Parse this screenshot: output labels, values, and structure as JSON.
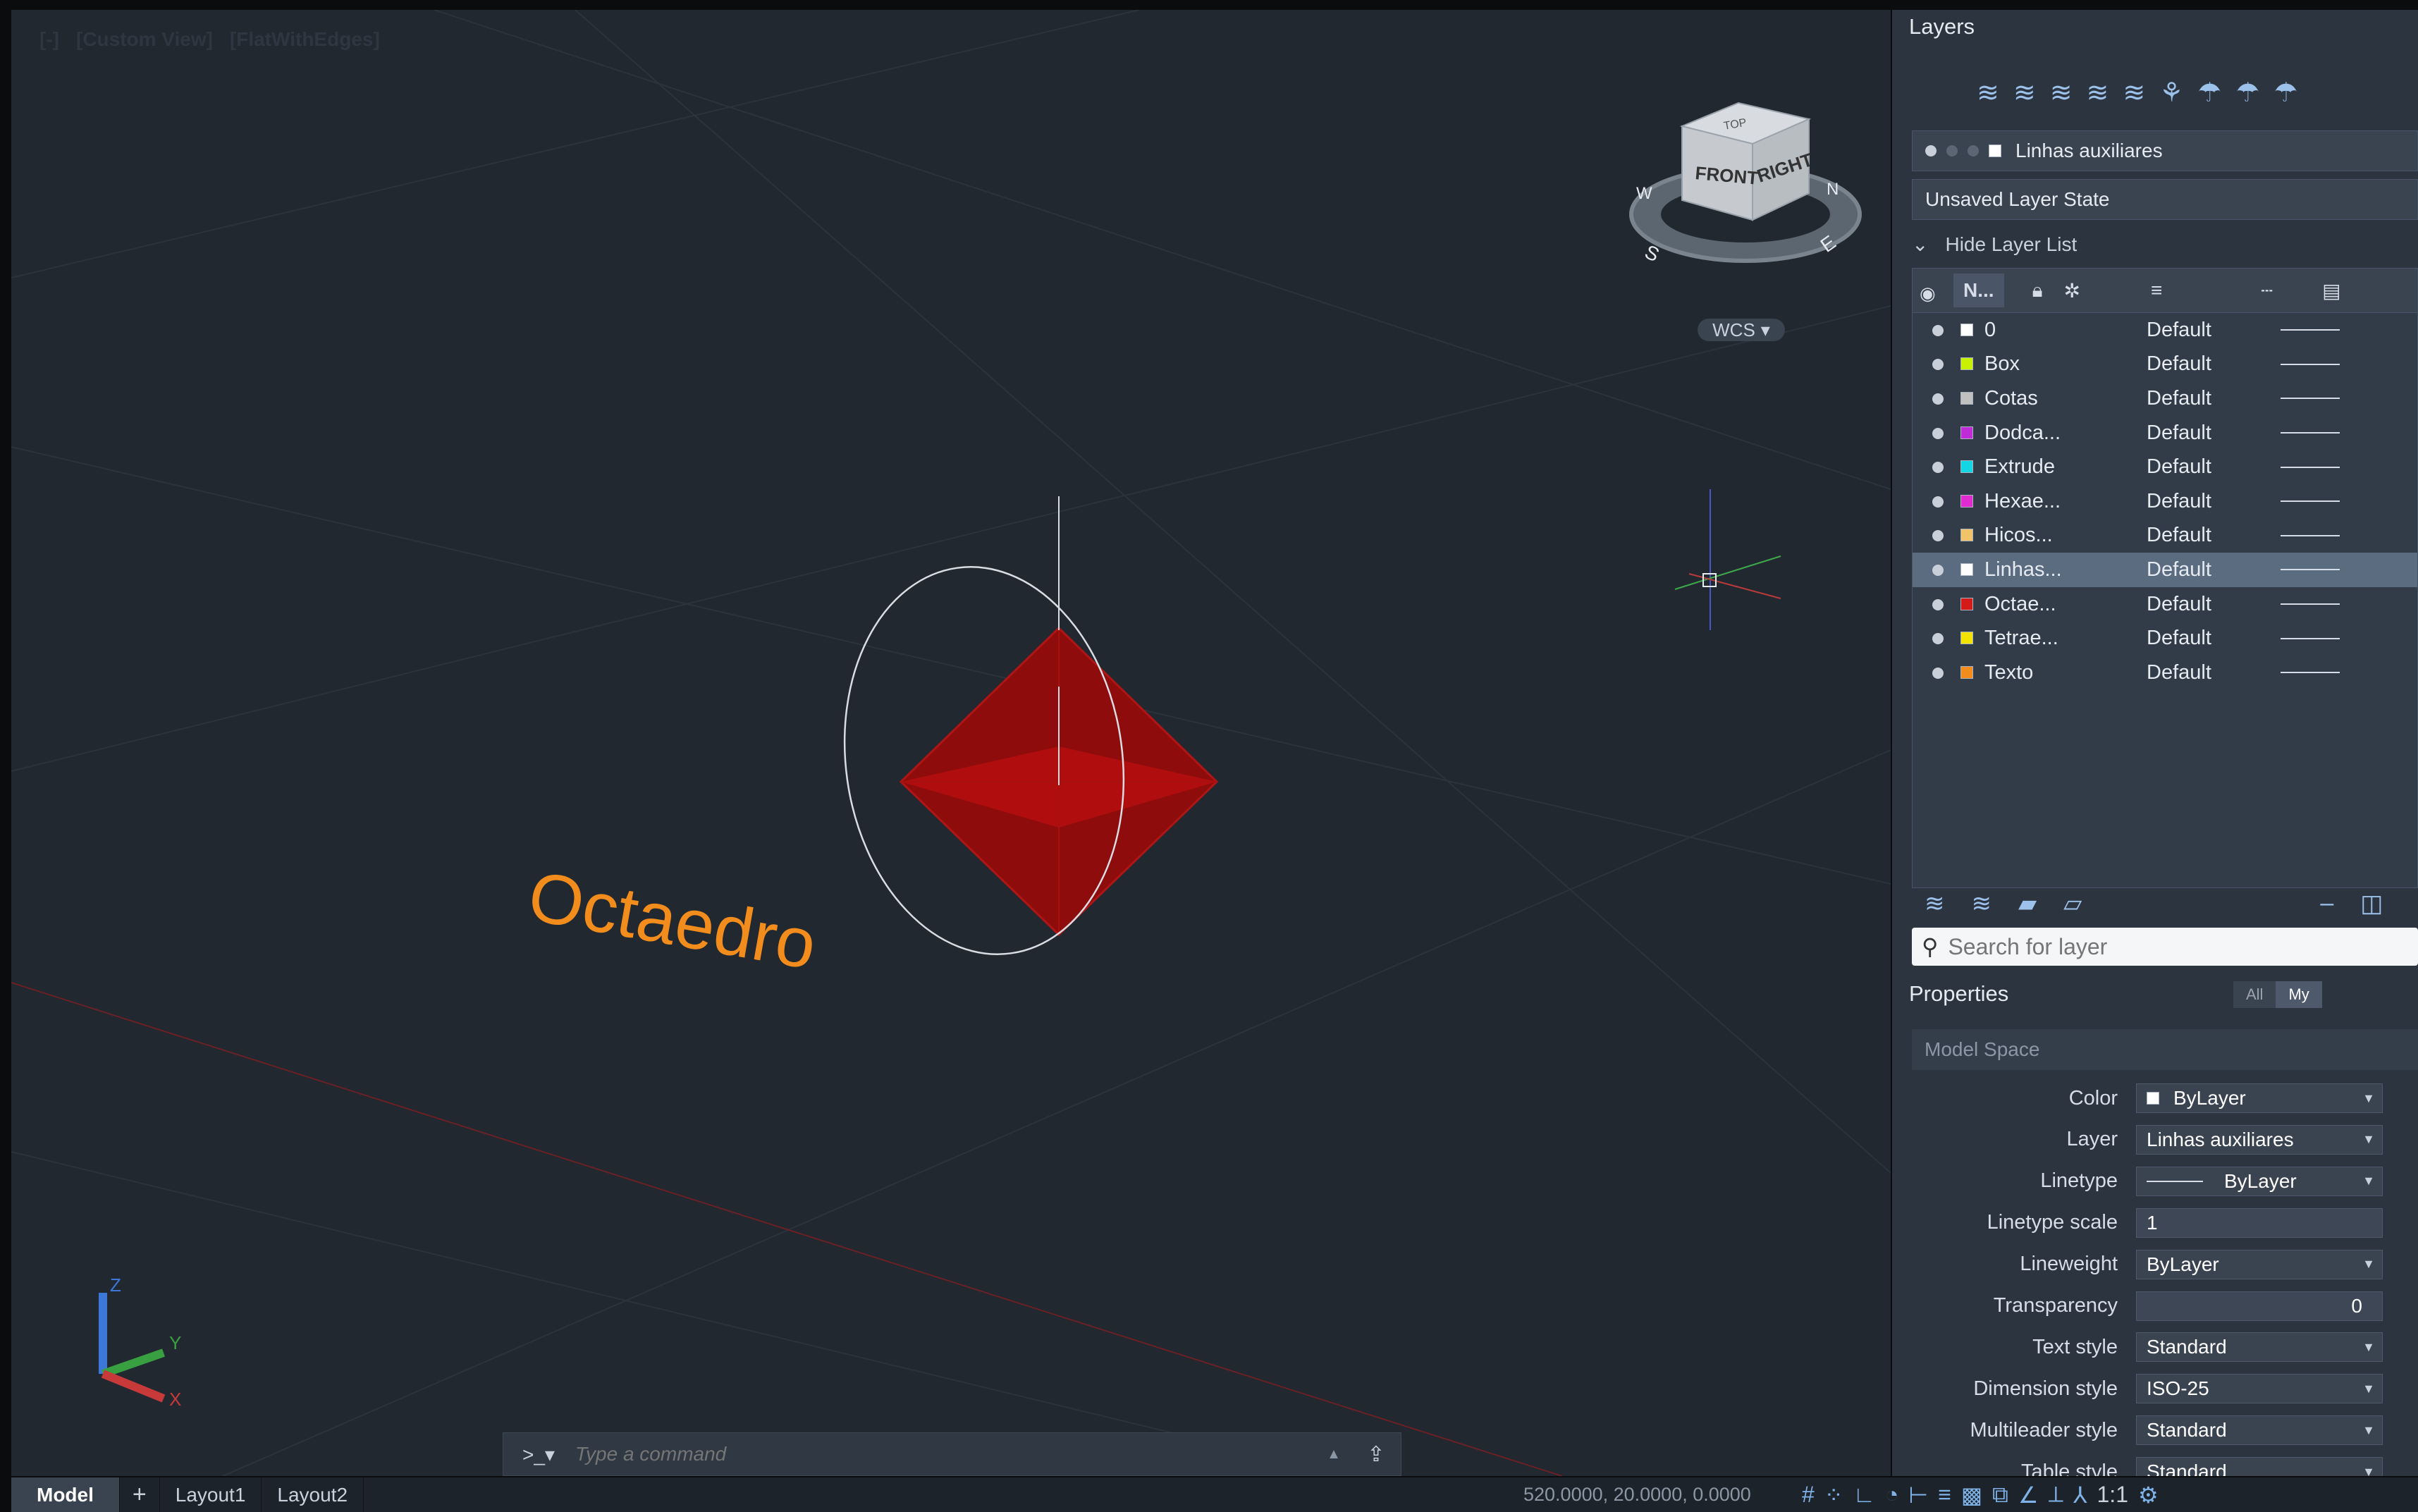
{
  "viewport": {
    "controls": [
      "[-]",
      "[Custom View]",
      "[FlatWithEdges]"
    ],
    "object_label": "Octaedro",
    "viewcube": {
      "front": "FRONT",
      "right": "RIGHT",
      "top": "TOP",
      "compass": [
        "W",
        "S",
        "E",
        "N"
      ]
    },
    "wcs_label": "WCS",
    "ucs_axes": [
      "X",
      "Y",
      "Z"
    ]
  },
  "command": {
    "prompt": ">_▾",
    "placeholder": "Type a command"
  },
  "statusbar": {
    "tabs": [
      "Model",
      "+",
      "Layout1",
      "Layout2"
    ],
    "coords": "520.0000, 20.0000, 0.0000",
    "scale": "1:1"
  },
  "layers": {
    "title": "Layers",
    "current_layer": "Linhas auxiliares",
    "layer_state": "Unsaved Layer State",
    "hide_list_label": "Hide Layer List",
    "name_col": "N...",
    "search_placeholder": "Search for layer",
    "rows": [
      {
        "name": "0",
        "color": "#ffffff",
        "linetype": "Default"
      },
      {
        "name": "Box",
        "color": "#c8f000",
        "linetype": "Default"
      },
      {
        "name": "Cotas",
        "color": "#c0c0c0",
        "linetype": "Default"
      },
      {
        "name": "Dodca...",
        "color": "#c02bd8",
        "linetype": "Default"
      },
      {
        "name": "Extrude",
        "color": "#12d6e4",
        "linetype": "Default"
      },
      {
        "name": "Hexae...",
        "color": "#e02bd0",
        "linetype": "Default"
      },
      {
        "name": "Hicos...",
        "color": "#f2c46a",
        "linetype": "Default"
      },
      {
        "name": "Linhas...",
        "color": "#ffffff",
        "linetype": "Default"
      },
      {
        "name": "Octae...",
        "color": "#d51a1a",
        "linetype": "Default"
      },
      {
        "name": "Tetrae...",
        "color": "#f2e400",
        "linetype": "Default"
      },
      {
        "name": "Texto",
        "color": "#f28c1c",
        "linetype": "Default"
      }
    ],
    "highlight_index": 7
  },
  "properties": {
    "title": "Properties",
    "filter_all": "All",
    "filter_my": "My",
    "space": "Model Space",
    "rows": [
      {
        "label": "Color",
        "value": "ByLayer"
      },
      {
        "label": "Layer",
        "value": "Linhas auxiliares"
      },
      {
        "label": "Linetype",
        "value": "ByLayer"
      },
      {
        "label": "Linetype scale",
        "value": "1"
      },
      {
        "label": "Lineweight",
        "value": "ByLayer"
      },
      {
        "label": "Transparency",
        "value": "0"
      },
      {
        "label": "Text style",
        "value": "Standard"
      },
      {
        "label": "Dimension style",
        "value": "ISO-25"
      },
      {
        "label": "Multileader style",
        "value": "Standard"
      },
      {
        "label": "Table style",
        "value": "Standard"
      }
    ]
  }
}
